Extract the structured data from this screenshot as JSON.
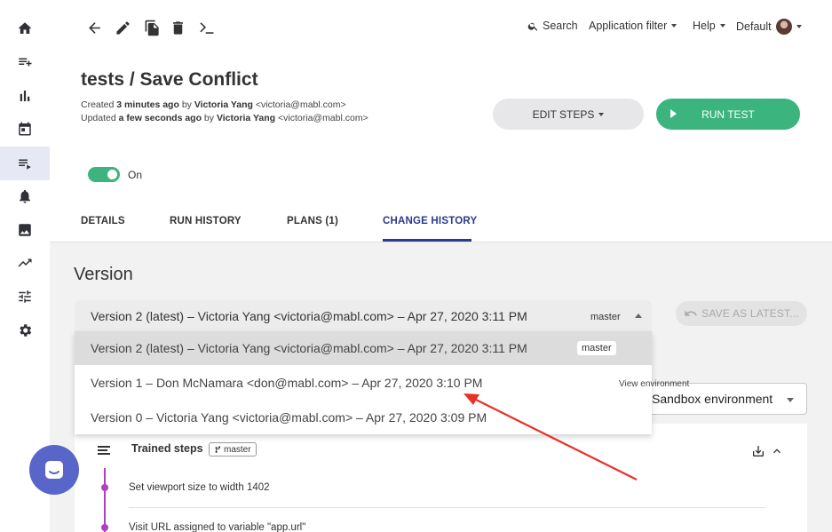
{
  "toolbar": {
    "search_label": "Search",
    "app_filter_label": "Application filter",
    "help_label": "Help",
    "workspace_label": "Default"
  },
  "header": {
    "title": "tests / Save Conflict",
    "created_prefix": "Created",
    "created_time": "3 minutes ago",
    "created_by_word": "by",
    "created_by": "Victoria Yang",
    "created_email": "<victoria@mabl.com>",
    "updated_prefix": "Updated",
    "updated_time": "a few seconds ago",
    "updated_by_word": "by",
    "updated_by": "Victoria Yang",
    "updated_email": "<victoria@mabl.com>",
    "edit_steps_label": "EDIT STEPS",
    "run_test_label": "RUN TEST",
    "toggle_label": "On"
  },
  "tabs": [
    {
      "label": "DETAILS"
    },
    {
      "label": "RUN HISTORY"
    },
    {
      "label": "PLANS (1)"
    },
    {
      "label": "CHANGE HISTORY"
    }
  ],
  "version": {
    "title": "Version",
    "selected": "Version 2 (latest) – Victoria Yang <victoria@mabl.com> – Apr 27, 2020 3:11 PM",
    "selected_badge": "master",
    "save_as_latest_label": "SAVE AS LATEST...",
    "options": [
      {
        "label": "Version 2 (latest) – Victoria Yang <victoria@mabl.com> – Apr 27, 2020 3:11 PM",
        "badge": "master"
      },
      {
        "label": "Version 1 – Don McNamara <don@mabl.com> – Apr 27, 2020 3:10 PM"
      },
      {
        "label": "Version 0 – Victoria Yang <victoria@mabl.com> – Apr 27, 2020 3:09 PM"
      }
    ]
  },
  "environment": {
    "label": "View environment",
    "value": "Sandbox environment"
  },
  "steps": {
    "title": "Trained steps",
    "branch": "master",
    "items": [
      {
        "text": "Set viewport size to width 1402"
      },
      {
        "text": "Visit URL assigned to variable \"app.url\""
      }
    ]
  },
  "colors": {
    "accent_green": "#3bb47e",
    "tab_active": "#2b3a8c",
    "timeline": "#b23fbf",
    "chat": "#5865c9",
    "annotation_arrow": "#e8312a"
  }
}
